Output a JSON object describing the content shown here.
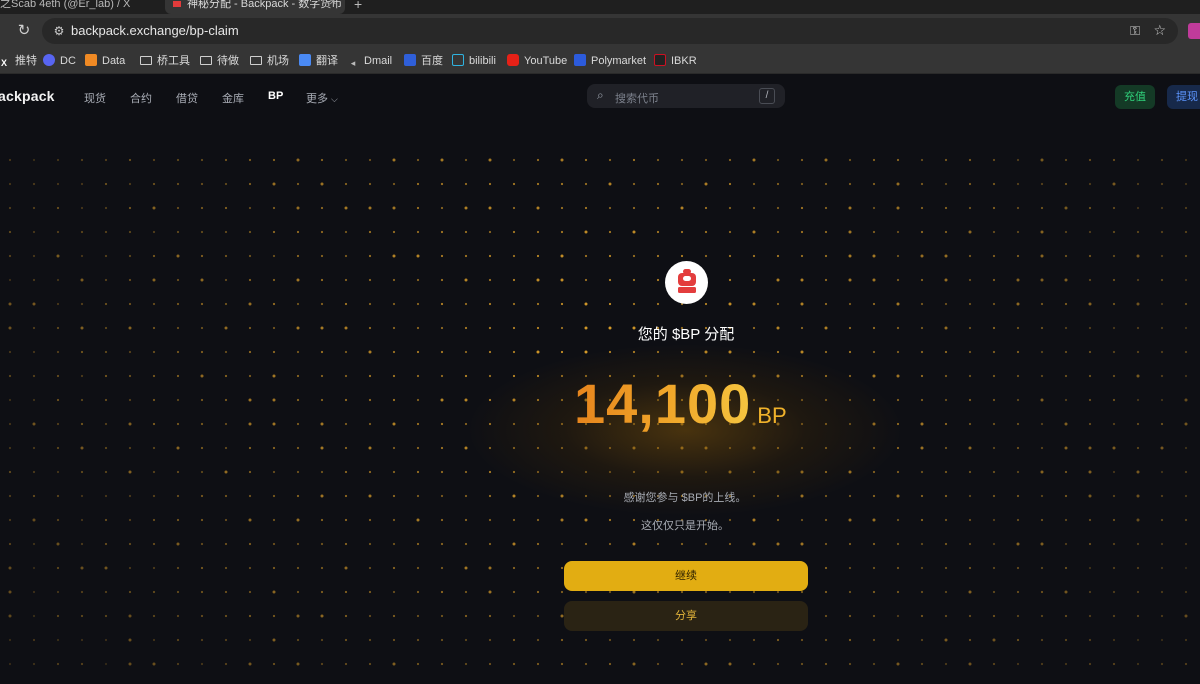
{
  "browser": {
    "tabs": [
      {
        "label": "之Scab 4eth (@Er_lab) / X"
      },
      {
        "label": "神秘分配 - Backpack - 数字货币"
      }
    ],
    "new_tab": "+",
    "url": "backpack.exchange/bp-claim",
    "bookmarks": [
      {
        "label": "推特",
        "icon": "x-logo-icon"
      },
      {
        "label": "DC",
        "icon": "discord-icon"
      },
      {
        "label": "Data",
        "icon": "data-icon"
      },
      {
        "label": "桥工具",
        "icon": "folder-icon"
      },
      {
        "label": "待做",
        "icon": "folder-icon"
      },
      {
        "label": "机场",
        "icon": "folder-icon"
      },
      {
        "label": "翻译",
        "icon": "translate-icon"
      },
      {
        "label": "Dmail",
        "icon": "dmail-icon"
      },
      {
        "label": "百度",
        "icon": "baidu-icon"
      },
      {
        "label": "bilibili",
        "icon": "bilibili-icon"
      },
      {
        "label": "YouTube",
        "icon": "youtube-icon"
      },
      {
        "label": "Polymarket",
        "icon": "polymarket-icon"
      },
      {
        "label": "IBKR",
        "icon": "ibkr-icon"
      }
    ]
  },
  "nav": {
    "logo": "ackpack",
    "links": [
      "现货",
      "合约",
      "借贷",
      "金库",
      "BP",
      "更多"
    ],
    "active": "BP",
    "search_placeholder": "搜索代币",
    "search_shortcut": "/",
    "deposit_label": "充值",
    "withdraw_label": "提现"
  },
  "claim": {
    "title": "您的 $BP 分配",
    "amount": "14,100",
    "unit": "BP",
    "thanks": "感谢您参与 $BP的上线。",
    "subtitle": "这仅仅只是开始。",
    "continue_label": "继续",
    "share_label": "分享"
  },
  "colors": {
    "background": "#0e0f14",
    "accent": "#e2ad12",
    "deposit_green": "#2fd07a",
    "withdraw_blue": "#5d96ff",
    "brand_red": "#e33d3d"
  }
}
